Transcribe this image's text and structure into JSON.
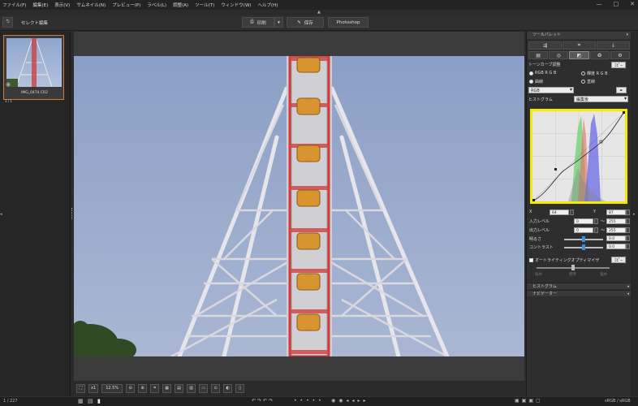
{
  "menu": [
    "ファイル(F)",
    "編集(E)",
    "表示(V)",
    "サムネイル(N)",
    "プレビュー(P)",
    "ラベル(L)",
    "調整(A)",
    "ツール(T)",
    "ウィンドウ(W)",
    "ヘルプ(H)"
  ],
  "window_controls": [
    "—",
    "□",
    "✕"
  ],
  "toolbar": {
    "mode_label": "セレクト編集",
    "print_label": "印刷",
    "save_label": "保存",
    "photoshop_label": "Photoshop"
  },
  "thumbnail": {
    "filename": "IMG_0474.CR2",
    "badge": "1 / 1"
  },
  "bottombar": {
    "fit_label": "⛶",
    "x1_label": "x1",
    "zoom": "12.5%"
  },
  "status": {
    "count": "1 / 227",
    "colorspace": "sRGB / sRGB"
  },
  "right_panel": {
    "title": "ツールパレット",
    "tone_curve_title": "トーンカーブ調整",
    "apply_btn": "ｺﾋﾟｰ",
    "radio_rgb": "RGB R G B",
    "radio_lum": "輝度 R G B",
    "radio_curve": "曲線",
    "radio_line": "直線",
    "channel": "RGB",
    "histogram_label": "ヒストグラム",
    "histogram_mode": "編集後",
    "x_label": "X",
    "x_value": "64",
    "y_label": "Y",
    "y_value": "87",
    "input_label": "入力レベル",
    "input_min": "0",
    "input_max": "255",
    "output_label": "出力レベル",
    "output_min": "0",
    "output_max": "255",
    "brightness_label": "明るさ",
    "brightness_value": "0.0",
    "contrast_label": "コントラスト",
    "contrast_value": "0.0",
    "auto_lighting_label": "オートライティングオプティマイザ",
    "auto_btn": "ｺﾋﾟｰ",
    "alo_levels": [
      "弱め",
      "標準",
      "強め"
    ],
    "section_histogram": "ヒストグラム",
    "section_navigator": "ナビゲーター"
  },
  "colors": {
    "highlight_border": "#f2ea00",
    "accent_blue": "#3a8fe0",
    "thumb_border": "#d07a3a"
  }
}
